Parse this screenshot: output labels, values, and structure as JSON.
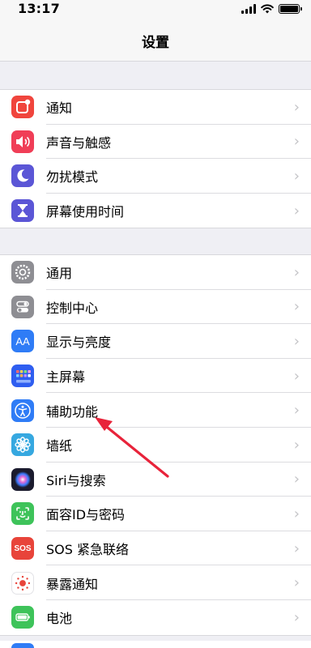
{
  "status_bar": {
    "time": "13:17"
  },
  "nav": {
    "title": "设置"
  },
  "group1": [
    {
      "label": "通知",
      "icon": "notifications-icon",
      "color": "#f0453d"
    },
    {
      "label": "声音与触感",
      "icon": "sound-icon",
      "color": "#f03e57"
    },
    {
      "label": "勿扰模式",
      "icon": "moon-icon",
      "color": "#5b56d6"
    },
    {
      "label": "屏幕使用时间",
      "icon": "hourglass-icon",
      "color": "#5b56d6"
    }
  ],
  "group2": [
    {
      "label": "通用",
      "icon": "gear-icon",
      "color": "#8e8e93"
    },
    {
      "label": "控制中心",
      "icon": "toggles-icon",
      "color": "#8e8e93"
    },
    {
      "label": "显示与亮度",
      "icon": "text-size-icon",
      "color": "#2f7cf6"
    },
    {
      "label": "主屏幕",
      "icon": "home-grid-icon",
      "color": "#2f5ef0"
    },
    {
      "label": "辅助功能",
      "icon": "accessibility-icon",
      "color": "#2f7cf6"
    },
    {
      "label": "墙纸",
      "icon": "flower-icon",
      "color": "#36a8e0"
    },
    {
      "label": "Siri与搜索",
      "icon": "siri-icon",
      "color": "#1b1b2e"
    },
    {
      "label": "面容ID与密码",
      "icon": "face-id-icon",
      "color": "#3ec35a"
    },
    {
      "label": "SOS 紧急联络",
      "icon": "sos-icon",
      "color": "#e8443a"
    },
    {
      "label": "暴露通知",
      "icon": "exposure-icon",
      "color": "#ffffff"
    },
    {
      "label": "电池",
      "icon": "battery-icon",
      "color": "#3ec35a"
    }
  ],
  "icons": {
    "sos_text": "SOS",
    "text_size_text": "AA"
  },
  "annotation": {
    "color": "#e8233a"
  }
}
